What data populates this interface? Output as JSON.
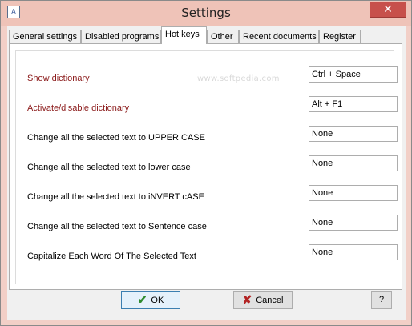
{
  "window": {
    "title": "Settings",
    "icon": "app-icon",
    "icon_text": "A",
    "close_label": "✕"
  },
  "tabs": [
    {
      "label": "General settings",
      "active": false
    },
    {
      "label": "Disabled programs",
      "active": false
    },
    {
      "label": "Hot keys",
      "active": true
    },
    {
      "label": "Other",
      "active": false
    },
    {
      "label": "Recent documents",
      "active": false
    },
    {
      "label": "Register",
      "active": false
    }
  ],
  "watermark": "www.softpedia.com",
  "hotkeys": [
    {
      "label": "Show dictionary",
      "value": "Ctrl + Space",
      "highlight": true
    },
    {
      "label": "Activate/disable dictionary",
      "value": "Alt + F1",
      "highlight": true
    },
    {
      "label": "Change all the selected text to UPPER CASE",
      "value": "None",
      "highlight": false
    },
    {
      "label": "Change all the selected text to lower case",
      "value": "None",
      "highlight": false
    },
    {
      "label": "Change all the selected text to iNVERT cASE",
      "value": "None",
      "highlight": false
    },
    {
      "label": "Change all the selected text to Sentence case",
      "value": "None",
      "highlight": false
    },
    {
      "label": "Capitalize Each Word Of The Selected Text",
      "value": "None",
      "highlight": false
    }
  ],
  "buttons": {
    "ok": "OK",
    "cancel": "Cancel",
    "help": "?"
  },
  "colors": {
    "highlight_label": "#8b1a1a",
    "title_bar": "#efc3b8",
    "close_button": "#c7504b"
  }
}
